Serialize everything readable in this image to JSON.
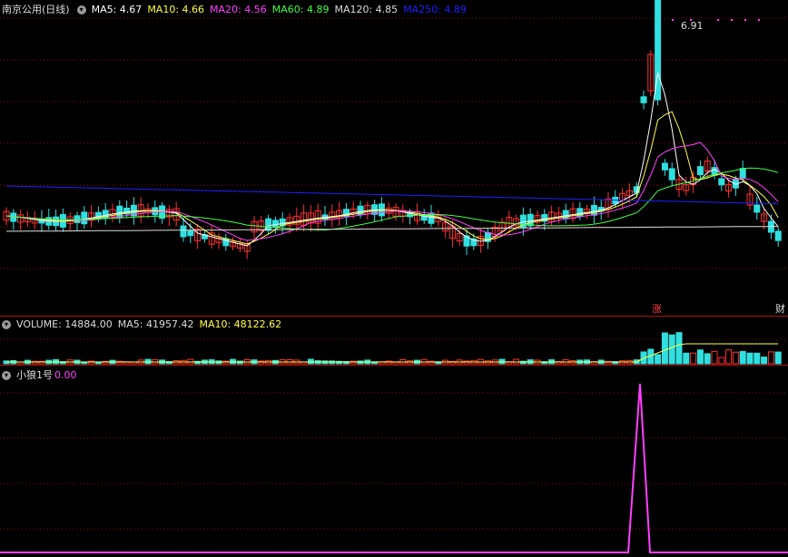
{
  "main": {
    "title": "南京公用(日线)",
    "ma": [
      {
        "label": "MA5: 4.67",
        "color": "#ffffff"
      },
      {
        "label": "MA10: 4.66",
        "color": "#ffff40"
      },
      {
        "label": "MA20: 4.56",
        "color": "#ff40ff"
      },
      {
        "label": "MA60: 4.89",
        "color": "#40ff40"
      },
      {
        "label": "MA120: 4.85",
        "color": "#dcdcdc"
      },
      {
        "label": "MA250: 4.89",
        "color": "#2020ff"
      }
    ],
    "high_label": "6.91",
    "tag_zhang": "涨",
    "tag_cai": "财"
  },
  "volume": {
    "title": "VOLUME: 14884.00",
    "ma5": "MA5: 41957.42",
    "ma10": "MA10: 48122.62"
  },
  "indicator": {
    "title": "小狼1号",
    "value": "0.00"
  },
  "colors": {
    "up": "#ff3030",
    "down": "#30e0e0",
    "grid": "#8a1010"
  }
}
